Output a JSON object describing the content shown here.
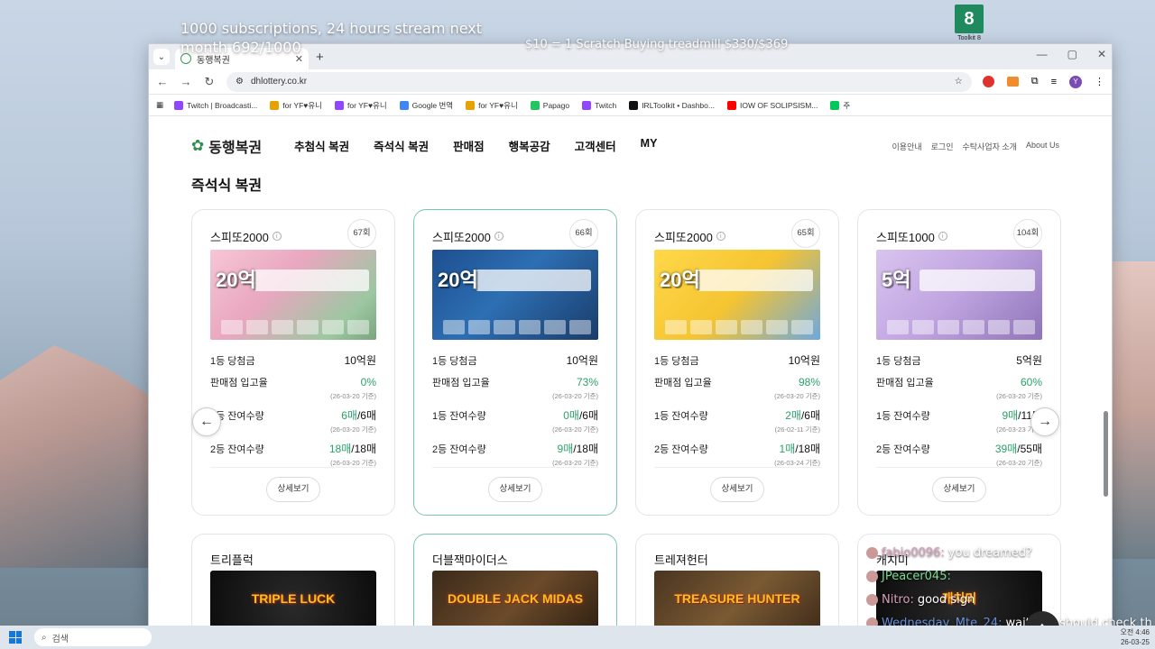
{
  "overlay": {
    "subscriptions": "1000 subscriptions, 24 hours stream next month 692/1000",
    "scratch_info": "$10 = 1 Scratch Buying treadmill $330/$369",
    "logo_text": "8",
    "logo_caption": "Toolkit 8"
  },
  "browser": {
    "tab_title": "동행복권",
    "url": "dhlottery.co.kr",
    "avatar_letter": "Y",
    "bookmarks": [
      {
        "label": "Twitch | Broadcasti...",
        "color": "#9146ff"
      },
      {
        "label": "for YF♥유니",
        "color": "#e5a200"
      },
      {
        "label": "for YF♥유니",
        "color": "#9146ff"
      },
      {
        "label": "Google 번역",
        "color": "#4285f4"
      },
      {
        "label": "for YF♥유니",
        "color": "#e5a200"
      },
      {
        "label": "Papago",
        "color": "#22c55e"
      },
      {
        "label": "Twitch",
        "color": "#9146ff"
      },
      {
        "label": "IRLToolkit • Dashbo...",
        "color": "#111111"
      },
      {
        "label": "IOW OF SOLIPSISM...",
        "color": "#ff0000"
      },
      {
        "label": "주",
        "color": "#03c75a"
      }
    ]
  },
  "site": {
    "logo": "동행복권",
    "nav": [
      "추첨식 복권",
      "즉석식 복권",
      "판매점",
      "행복공감",
      "고객센터",
      "MY"
    ],
    "util": [
      "이용안내",
      "로그인",
      "수탁사업자 소개",
      "About Us"
    ],
    "page_title": "즉석식 복권",
    "labels": {
      "first_prize": "1등 당첨금",
      "store_rate": "판매점 입고율",
      "first_left": "1등 잔여수량",
      "second_left": "2등 잔여수량",
      "detail": "상세보기"
    },
    "cards": [
      {
        "name": "스피또2000",
        "round": "67회",
        "ticket_amount": "20억",
        "prize": "10억원",
        "store_rate": "0%",
        "store_date": "(26-03-20 기준)",
        "first_left": "6매",
        "first_total": "/6매",
        "first_date": "(26-03-20 기준)",
        "second_left": "18매",
        "second_total": "/18매",
        "second_date": "(26-03-20 기준)"
      },
      {
        "name": "스피또2000",
        "round": "66회",
        "ticket_amount": "20억",
        "prize": "10억원",
        "store_rate": "73%",
        "store_date": "(26-03-20 기준)",
        "first_left": "0매",
        "first_total": "/6매",
        "first_date": "(26-03-20 기준)",
        "second_left": "9매",
        "second_total": "/18매",
        "second_date": "(26-03-20 기준)"
      },
      {
        "name": "스피또2000",
        "round": "65회",
        "ticket_amount": "20억",
        "prize": "10억원",
        "store_rate": "98%",
        "store_date": "(26-03-20 기준)",
        "first_left": "2매",
        "first_total": "/6매",
        "first_date": "(26-02-11 기준)",
        "second_left": "1매",
        "second_total": "/18매",
        "second_date": "(26-03-24 기준)"
      },
      {
        "name": "스피또1000",
        "round": "104회",
        "ticket_amount": "5억",
        "prize": "5억원",
        "store_rate": "60%",
        "store_date": "(26-03-20 기준)",
        "first_left": "9매",
        "first_total": "/11매",
        "first_date": "(26-03-23 기준)",
        "second_left": "39매",
        "second_total": "/55매",
        "second_date": "(26-03-20 기준)"
      }
    ],
    "cards2": [
      {
        "name": "트리플럭",
        "img_text": "TRIPLE LUCK"
      },
      {
        "name": "더블잭마이더스",
        "img_text": "DOUBLE JACK MIDAS"
      },
      {
        "name": "트레져헌터",
        "img_text": "TREASURE HUNTER"
      },
      {
        "name": "캐치미",
        "img_text": "캐치미"
      }
    ]
  },
  "chat": [
    {
      "user": "fabio0096:",
      "msg": "you dreamed?",
      "color": "pink"
    },
    {
      "user": "JPeacer045:",
      "msg": "",
      "color": "green"
    },
    {
      "user": "Nitro:",
      "msg": "good sign",
      "color": "pink"
    },
    {
      "user": "Wednesday_Mte_24:",
      "msg": "wait you should check th",
      "color": "blue"
    }
  ],
  "taskbar": {
    "search_placeholder": "검색",
    "time": "오전 4:46",
    "date": "26-03-25"
  }
}
